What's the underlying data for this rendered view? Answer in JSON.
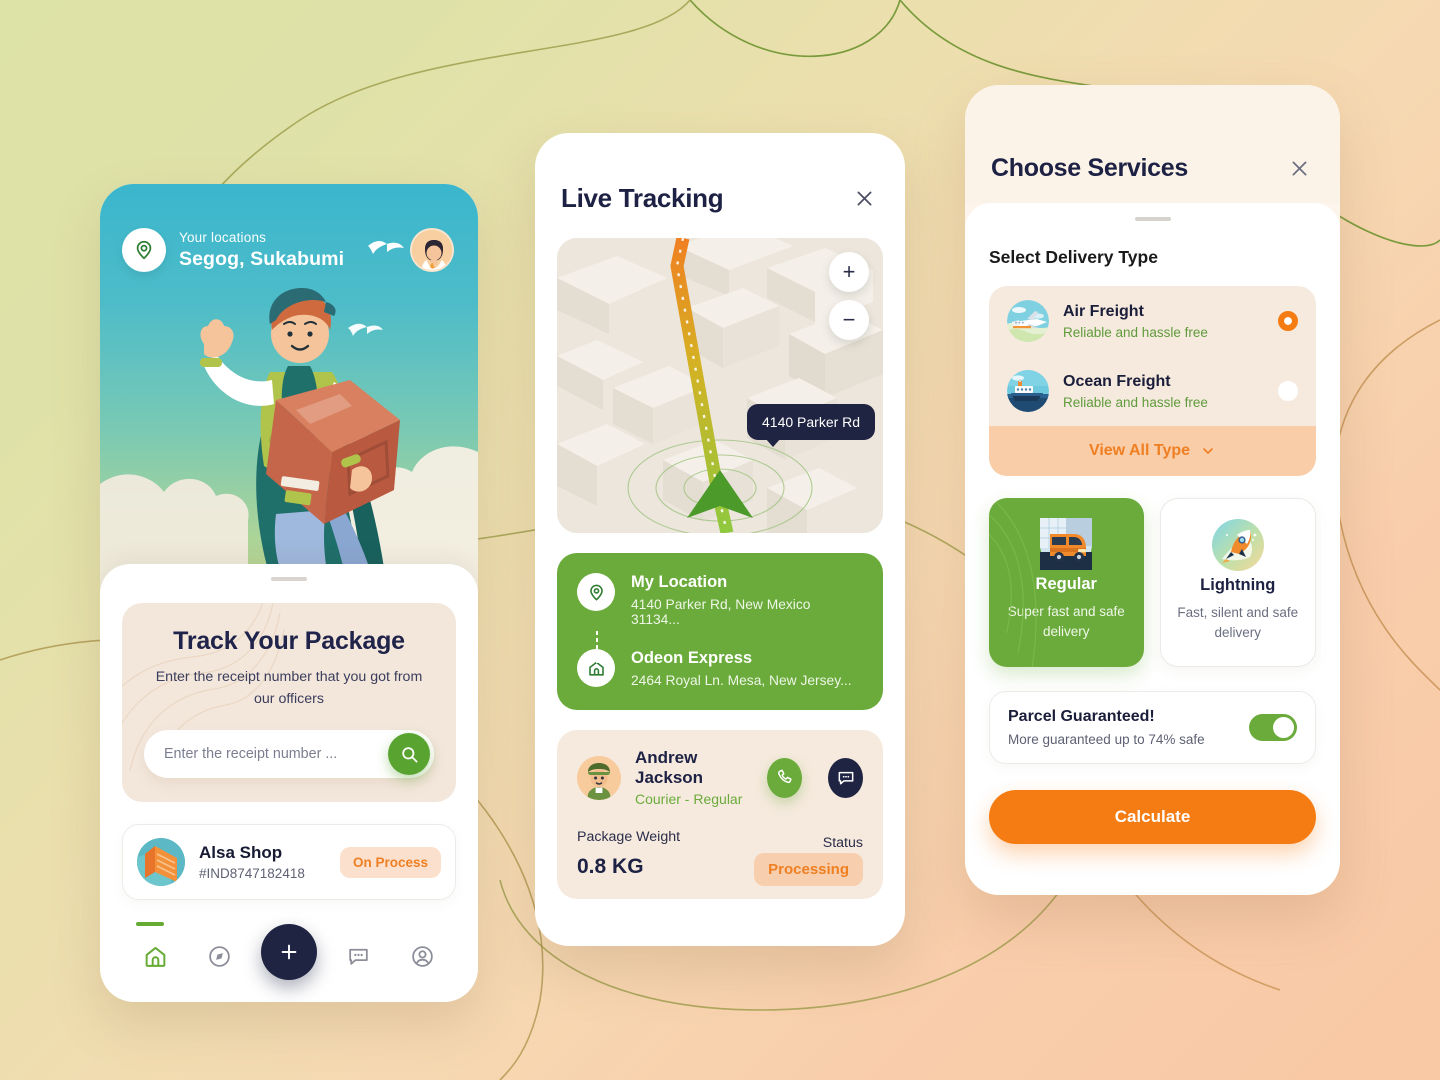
{
  "background": {
    "start_color": "#dde2a6",
    "end_color": "#f9c8a4"
  },
  "phone_home": {
    "hero": {
      "location_label": "Your locations",
      "location_value": "Segog, Sukabumi",
      "pin_icon": "location-pin-icon",
      "avatar_icon": "user-avatar"
    },
    "track_card": {
      "title": "Track Your Package",
      "subtitle": "Enter the receipt number that you got from our officers",
      "input_placeholder": "Enter the receipt number ...",
      "input_value": "",
      "search_icon": "search-icon",
      "search_button_color": "#59a430"
    },
    "shop_card": {
      "name": "Alsa Shop",
      "receipt_id": "#IND8747182418",
      "status": "On Process",
      "status_color": "#ef7f22",
      "icon": "shop-building-icon"
    },
    "navbar": {
      "items": [
        {
          "name": "home",
          "icon": "home-icon",
          "active": true
        },
        {
          "name": "explore",
          "icon": "compass-icon",
          "active": false
        },
        {
          "name": "add",
          "icon": "plus-icon",
          "active": false
        },
        {
          "name": "chat",
          "icon": "chat-bubble-icon",
          "active": false
        },
        {
          "name": "profile",
          "icon": "user-circle-icon",
          "active": false
        }
      ]
    }
  },
  "phone_tracking": {
    "title": "Live Tracking",
    "close_icon": "close-icon",
    "map": {
      "zoom_in_label": "+",
      "zoom_out_label": "−",
      "tooltip": "4140 Parker Rd",
      "marker_icon": "navigation-arrow-icon"
    },
    "route": {
      "origin": {
        "title": "My Location",
        "address": "4140 Parker Rd, New Mexico 31134...",
        "icon": "location-pin-icon"
      },
      "destination": {
        "title": "Odeon Express",
        "address": "2464 Royal Ln. Mesa, New Jersey...",
        "icon": "home-icon"
      },
      "card_color": "#6aab3b"
    },
    "courier": {
      "name": "Andrew Jackson",
      "role": "Courier - Regular",
      "call_icon": "phone-icon",
      "chat_icon": "chat-bubble-icon",
      "weight_label": "Package Weight",
      "weight_value": "0.8 KG",
      "status_label": "Status",
      "status_value": "Processing",
      "status_color": "#ef7f22"
    }
  },
  "phone_services": {
    "title": "Choose Services",
    "close_icon": "close-icon",
    "section_title": "Select Delivery Type",
    "delivery_types": [
      {
        "name": "Air Freight",
        "desc": "Reliable and hassle free",
        "icon": "airplane-icon",
        "selected": true
      },
      {
        "name": "Ocean Freight",
        "desc": "Reliable and hassle free",
        "icon": "ship-icon",
        "selected": false
      }
    ],
    "view_all_label": "View All Type",
    "view_all_icon": "chevron-down-icon",
    "speeds": [
      {
        "name": "Regular",
        "desc": "Super fast and safe delivery",
        "icon": "delivery-van-icon",
        "selected": true
      },
      {
        "name": "Lightning",
        "desc": "Fast, silent and safe delivery",
        "icon": "rocket-icon",
        "selected": false
      }
    ],
    "guarantee": {
      "title": "Parcel Guaranteed!",
      "subtitle": "More guaranteed up to 74% safe",
      "enabled": true
    },
    "calculate_label": "Calculate",
    "accent_color": "#f57c12"
  }
}
